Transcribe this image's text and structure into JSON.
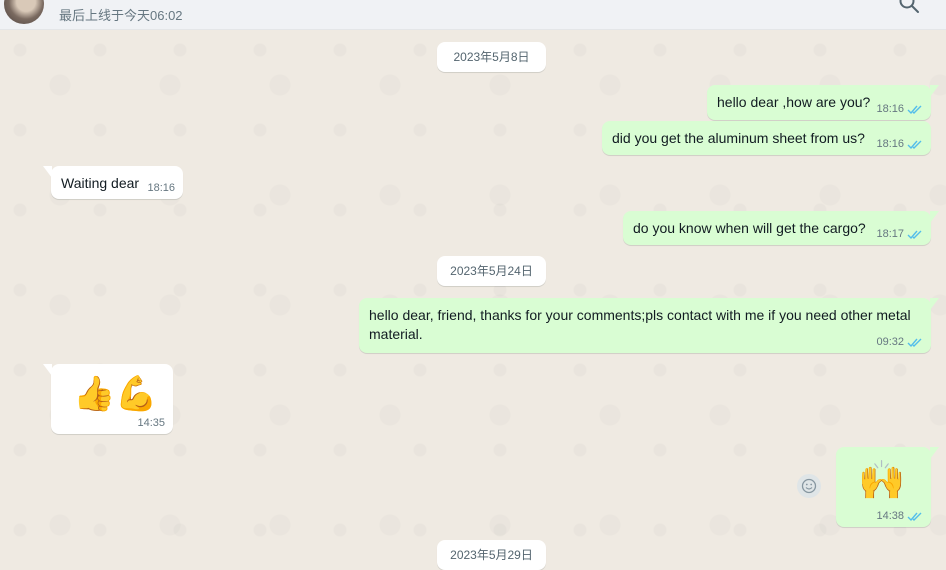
{
  "header": {
    "last_seen": "最后上线于今天06:02",
    "search_icon": "search-icon",
    "avatar": "avatar"
  },
  "colors": {
    "outgoing_bubble": "#d9fdd3",
    "incoming_bubble": "#ffffff",
    "read_tick": "#53bdeb",
    "chat_background": "#efeae2"
  },
  "dates": {
    "d1": "2023年5月8日",
    "d2": "2023年5月24日",
    "d3": "2023年5月29日"
  },
  "messages": [
    {
      "dir": "out",
      "text": "hello dear ,how are you?",
      "time": "18:16",
      "status": "read"
    },
    {
      "dir": "out",
      "text": "did you get the aluminum sheet from us?",
      "time": "18:16",
      "status": "read"
    },
    {
      "dir": "in",
      "text": "Waiting dear",
      "time": "18:16"
    },
    {
      "dir": "out",
      "text": "do you know when will get the cargo?",
      "time": "18:17",
      "status": "read"
    },
    {
      "dir": "out",
      "text_line1": "hello dear, friend, thanks for your comments;pls contact with me if you need other metal",
      "text_line2": "material.",
      "time": "09:32",
      "status": "read"
    },
    {
      "dir": "in",
      "emoji": "👍💪",
      "time": "14:35"
    },
    {
      "dir": "out",
      "emoji": "🙌",
      "time": "14:38",
      "status": "read"
    }
  ]
}
